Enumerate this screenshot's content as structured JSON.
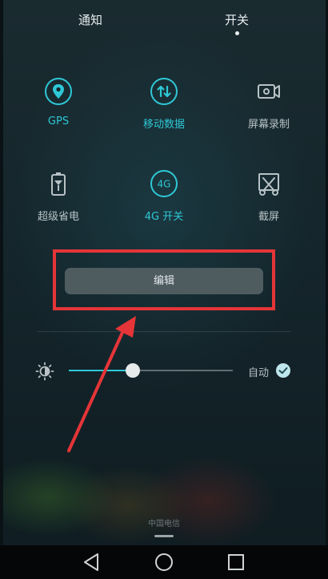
{
  "tabs": {
    "notifications": "通知",
    "switches": "开关",
    "active": "switches"
  },
  "toggles": [
    {
      "label": "GPS",
      "icon": "gps-icon",
      "on": true
    },
    {
      "label": "移动数据",
      "icon": "mobile-data-icon",
      "on": true
    },
    {
      "label": "屏幕录制",
      "icon": "screen-record-icon",
      "on": false
    },
    {
      "label": "超级省电",
      "icon": "battery-saver-icon",
      "on": false
    },
    {
      "label": "4G 开关",
      "icon": "4g-icon",
      "icon_text": "4G",
      "on": true
    },
    {
      "label": "截屏",
      "icon": "screenshot-icon",
      "on": false
    }
  ],
  "edit_button": {
    "label": "编辑"
  },
  "brightness": {
    "level": 0.39,
    "auto_label": "自动",
    "auto_checked": true
  },
  "carrier": "中国电信",
  "colors": {
    "accent": "#2fc8d6",
    "highlight": "#e53538",
    "background": "#14252b"
  },
  "navbar": {
    "back": "back-icon",
    "home": "home-icon",
    "recents": "recents-icon"
  }
}
